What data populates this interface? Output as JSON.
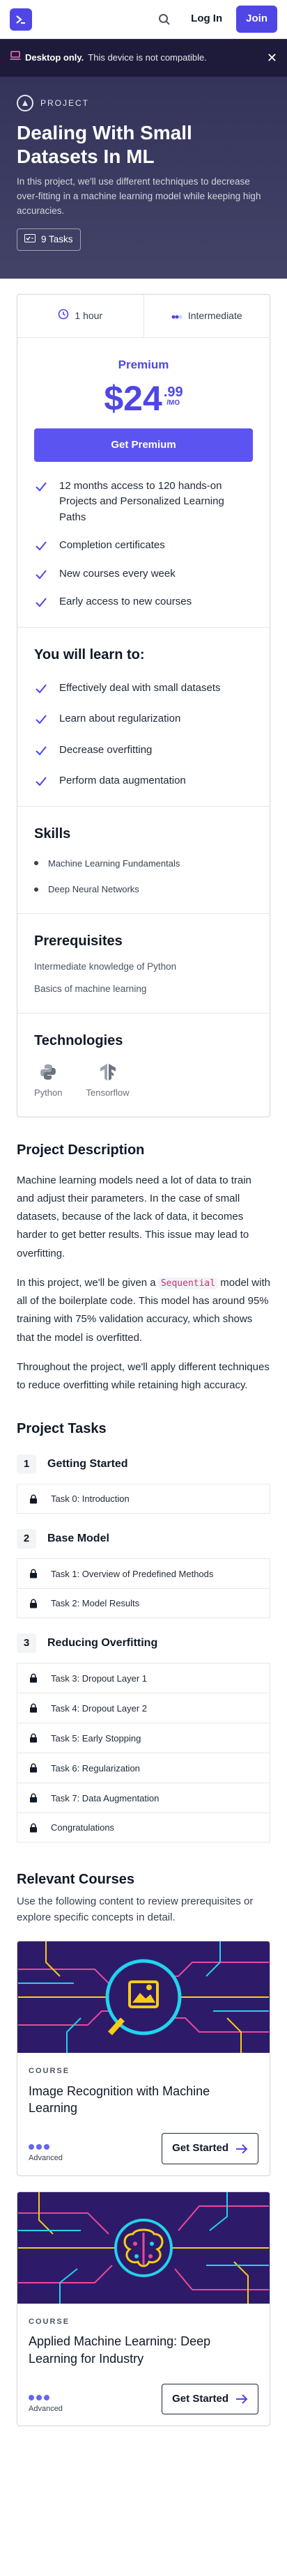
{
  "nav": {
    "login": "Log In",
    "join": "Join"
  },
  "banner": {
    "title": "Desktop only.",
    "message": "This device is not compatible.",
    "close": "✕"
  },
  "hero": {
    "tag": "PROJECT",
    "title": "Dealing With Small Datasets In ML",
    "description": "In this project, we'll use different techniques to decrease over-fitting in a machine learning model while keeping high accuracies.",
    "tasks_label": "9 Tasks"
  },
  "pricing": {
    "duration": "1 hour",
    "level": "Intermediate",
    "plan": "Premium",
    "price_dollars": "$24",
    "price_cents": ".99",
    "price_period": "/MO",
    "cta": "Get Premium",
    "features": [
      "12 months access to 120 hands-on Projects and Personalized Learning Paths",
      "Completion certificates",
      "New courses every week",
      "Early access to new courses"
    ]
  },
  "learn": {
    "title": "You will learn to:",
    "items": [
      "Effectively deal with small datasets",
      "Learn about regularization",
      "Decrease overfitting",
      "Perform data augmentation"
    ]
  },
  "skills": {
    "title": "Skills",
    "items": [
      "Machine Learning Fundamentals",
      "Deep Neural Networks"
    ]
  },
  "prerequisites": {
    "title": "Prerequisites",
    "items": [
      "Intermediate knowledge of Python",
      "Basics of machine learning"
    ]
  },
  "technologies": {
    "title": "Technologies",
    "items": [
      "Python",
      "Tensorflow"
    ]
  },
  "description": {
    "title": "Project Description",
    "p1": "Machine learning models need a lot of data to train and adjust their parameters. In the case of small datasets, because of the lack of data, it becomes harder to get better results. This issue may lead to overfitting.",
    "p2_before": "In this project, we'll be given a ",
    "p2_code": "Sequential",
    "p2_after": " model with all of the boilerplate code. This model has around 95% training with 75% validation accuracy, which shows that the model is overfitted.",
    "p3": "Throughout the project, we'll apply different techniques to reduce overfitting while retaining high accuracy."
  },
  "tasks": {
    "title": "Project Tasks",
    "groups": [
      {
        "num": "1",
        "title": "Getting Started",
        "items": [
          "Task 0: Introduction"
        ]
      },
      {
        "num": "2",
        "title": "Base Model",
        "items": [
          "Task 1: Overview of Predefined Methods",
          "Task 2: Model Results"
        ]
      },
      {
        "num": "3",
        "title": "Reducing Overfitting",
        "items": [
          "Task 3: Dropout Layer 1",
          "Task 4: Dropout Layer 2",
          "Task 5: Early Stopping",
          "Task 6: Regularization",
          "Task 7: Data Augmentation",
          "Congratulations"
        ]
      }
    ]
  },
  "relevant": {
    "title": "Relevant Courses",
    "subtitle": "Use the following content to review prerequisites or explore specific concepts in detail.",
    "courses": [
      {
        "tag": "COURSE",
        "title": "Image Recognition with Machine Learning",
        "level": "Advanced",
        "cta": "Get Started"
      },
      {
        "tag": "COURSE",
        "title": "Applied Machine Learning: Deep Learning for Industry",
        "level": "Advanced",
        "cta": "Get Started"
      }
    ]
  },
  "colors": {
    "accent": "#4f46e5",
    "hero_bg": "#3b3a5c",
    "banner_bg": "#1e1b3a",
    "code": "#db2777",
    "course_img_bg": "#2d1b69"
  },
  "icons": [
    "logo-icon",
    "search-icon",
    "laptop-icon",
    "close-icon",
    "project-icon",
    "tasks-icon",
    "clock-icon",
    "level-icon",
    "check-icon",
    "lock-icon",
    "python-icon",
    "tensorflow-icon",
    "arrow-right-icon"
  ]
}
